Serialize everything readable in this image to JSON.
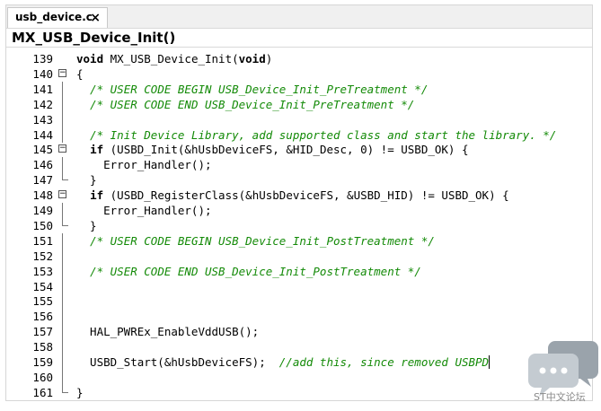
{
  "tab": {
    "label": "usb_device.c",
    "close": "×"
  },
  "outline": {
    "function": "MX_USB_Device_Init()"
  },
  "lines": [
    {
      "num": "139",
      "fold": "",
      "code": "void MX_USB_Device_Init(void)"
    },
    {
      "num": "140",
      "fold": "start",
      "code": "{"
    },
    {
      "num": "141",
      "fold": "line",
      "code": "  /* USER CODE BEGIN USB_Device_Init_PreTreatment */"
    },
    {
      "num": "142",
      "fold": "line",
      "code": "  /* USER CODE END USB_Device_Init_PreTreatment */"
    },
    {
      "num": "143",
      "fold": "line",
      "code": ""
    },
    {
      "num": "144",
      "fold": "line",
      "code": "  /* Init Device Library, add supported class and start the library. */"
    },
    {
      "num": "145",
      "fold": "start",
      "code": "  if (USBD_Init(&hUsbDeviceFS, &HID_Desc, 0) != USBD_OK) {"
    },
    {
      "num": "146",
      "fold": "line",
      "code": "    Error_Handler();"
    },
    {
      "num": "147",
      "fold": "end",
      "code": "  }"
    },
    {
      "num": "148",
      "fold": "start",
      "code": "  if (USBD_RegisterClass(&hUsbDeviceFS, &USBD_HID) != USBD_OK) {"
    },
    {
      "num": "149",
      "fold": "line",
      "code": "    Error_Handler();"
    },
    {
      "num": "150",
      "fold": "end",
      "code": "  }"
    },
    {
      "num": "151",
      "fold": "line",
      "code": "  /* USER CODE BEGIN USB_Device_Init_PostTreatment */"
    },
    {
      "num": "152",
      "fold": "line",
      "code": ""
    },
    {
      "num": "153",
      "fold": "line",
      "code": "  /* USER CODE END USB_Device_Init_PostTreatment */"
    },
    {
      "num": "154",
      "fold": "line",
      "code": ""
    },
    {
      "num": "155",
      "fold": "line",
      "code": ""
    },
    {
      "num": "156",
      "fold": "line",
      "code": ""
    },
    {
      "num": "157",
      "fold": "line",
      "code": "  HAL_PWREx_EnableVddUSB();"
    },
    {
      "num": "158",
      "fold": "line",
      "code": ""
    },
    {
      "num": "159",
      "fold": "line",
      "code": "  USBD_Start(&hUsbDeviceFS);  //add this, since removed USBPD"
    },
    {
      "num": "160",
      "fold": "line",
      "code": ""
    },
    {
      "num": "161",
      "fold": "end",
      "code": "}"
    }
  ],
  "watermark": {
    "text": "ST中文论坛"
  },
  "colors": {
    "comment": "#138a07",
    "keyword": "#000000"
  }
}
